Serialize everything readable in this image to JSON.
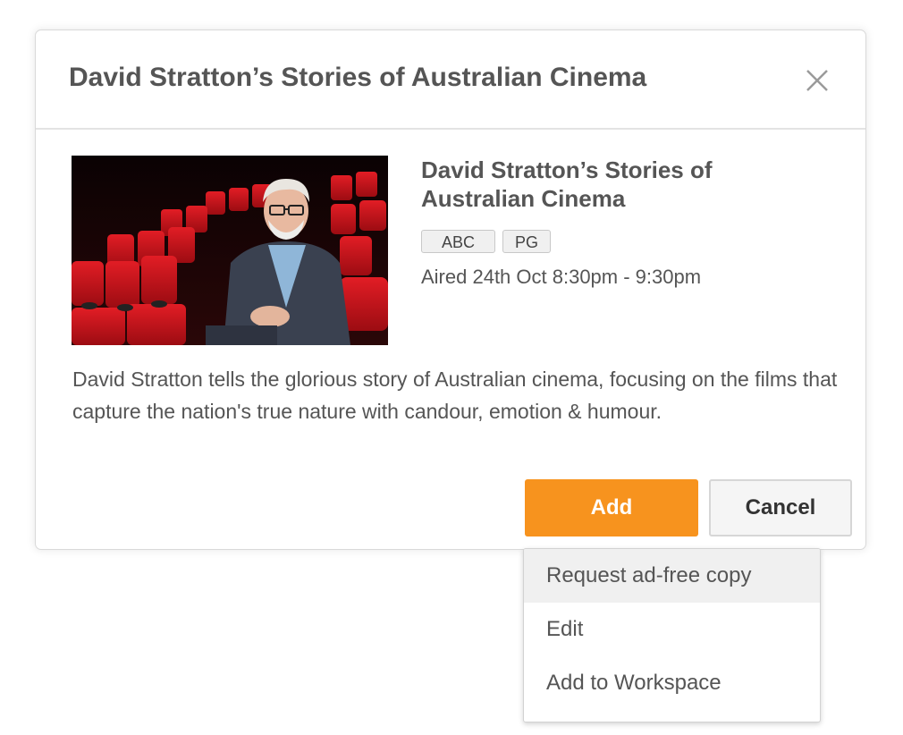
{
  "modal": {
    "title": "David Stratton’s Stories of Australian Cinema",
    "close_icon": "close-icon"
  },
  "program": {
    "title": "David Stratton’s Stories of Australian Cinema",
    "tags": [
      "ABC",
      "PG"
    ],
    "aired": "Aired 24th Oct 8:30pm - 9:30pm",
    "description": "David Stratton tells the glorious story of Australian cinema, focusing on the films that capture the nation's true nature with candour, emotion & humour."
  },
  "actions": {
    "add_label": "Add",
    "cancel_label": "Cancel"
  },
  "dropdown": {
    "items": [
      {
        "label": "Request ad-free copy"
      },
      {
        "label": "Edit"
      },
      {
        "label": "Add to Workspace"
      }
    ]
  },
  "colors": {
    "accent": "#f7931e",
    "text": "#555555",
    "cinema_seat_red": "#d4141b"
  }
}
